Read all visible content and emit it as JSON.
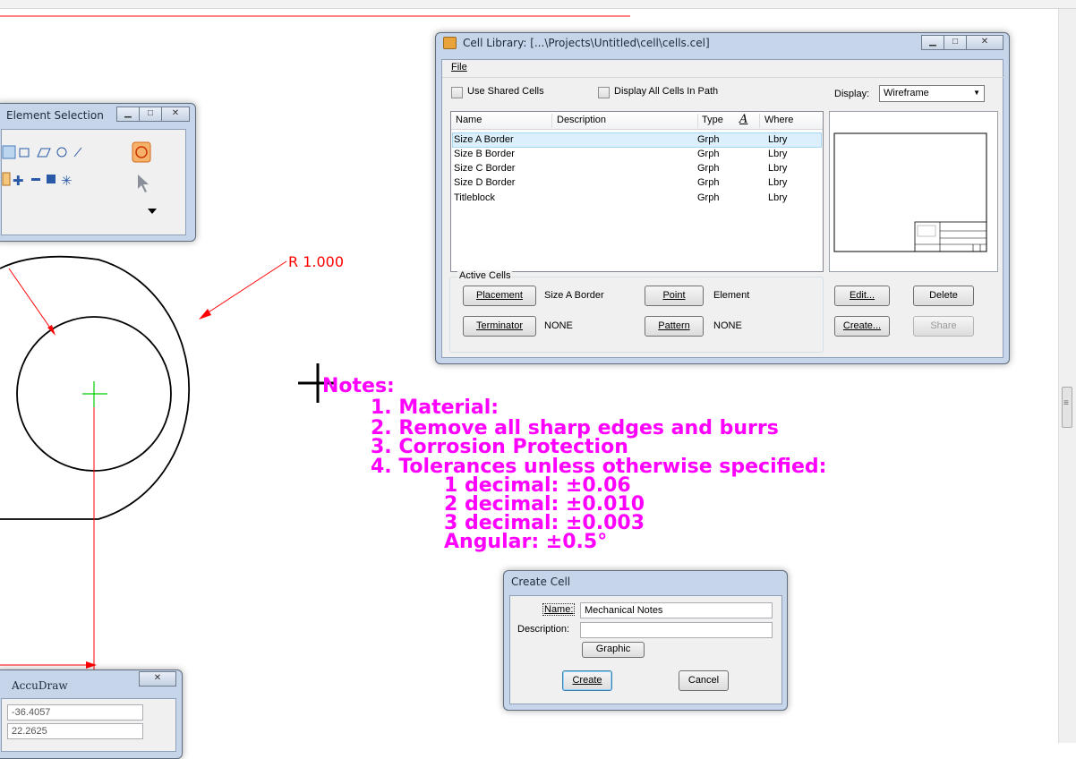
{
  "drawing": {
    "dimension_label": "R 1.000",
    "notes": {
      "heading": "Notes:",
      "lines": [
        "1. Material:",
        "2. Remove all sharp edges and burrs",
        "3. Corrosion Protection",
        "4. Tolerances unless otherwise specified:",
        "1 decimal: ±0.06",
        "2 decimal: ±0.010",
        "3 decimal: ±0.003",
        "Angular: ±0.5°"
      ]
    },
    "colors": {
      "notes": "#ff00ff",
      "dimension": "#ff0000",
      "geometry": "#000000",
      "center_mark": "#00cc00"
    }
  },
  "cell_library": {
    "title": "Cell Library: [...\\Projects\\Untitled\\cell\\cells.cel]",
    "menu": {
      "file": "File"
    },
    "use_shared_cells": "Use Shared Cells",
    "display_all_cells": "Display All Cells In Path",
    "display_label": "Display:",
    "display_value": "Wireframe",
    "columns": {
      "name": "Name",
      "description": "Description",
      "type": "Type",
      "where": "Where"
    },
    "rows": [
      {
        "name": "Size A Border",
        "type": "Grph",
        "where": "Lbry"
      },
      {
        "name": "Size B Border",
        "type": "Grph",
        "where": "Lbry"
      },
      {
        "name": "Size C Border",
        "type": "Grph",
        "where": "Lbry"
      },
      {
        "name": "Size D Border",
        "type": "Grph",
        "where": "Lbry"
      },
      {
        "name": "Titleblock",
        "type": "Grph",
        "where": "Lbry"
      }
    ],
    "active_cells_label": "Active Cells",
    "placement_btn": "Placement",
    "placement_value": "Size A Border",
    "point_btn": "Point",
    "point_value": "Element",
    "terminator_btn": "Terminator",
    "terminator_value": "NONE",
    "pattern_btn": "Pattern",
    "pattern_value": "NONE",
    "edit_btn": "Edit...",
    "delete_btn": "Delete",
    "create_btn": "Create...",
    "share_btn": "Share"
  },
  "element_selection": {
    "title": "Element Selection"
  },
  "create_cell": {
    "title": "Create Cell",
    "name_label": "Name:",
    "name_value": "Mechanical Notes",
    "description_label": "Description:",
    "description_value": "",
    "graphic_btn": "Graphic",
    "create_btn": "Create",
    "cancel_btn": "Cancel"
  },
  "accudraw": {
    "title": "AccuDraw",
    "x_value": "-36.4057",
    "y_value": "22.2625"
  }
}
